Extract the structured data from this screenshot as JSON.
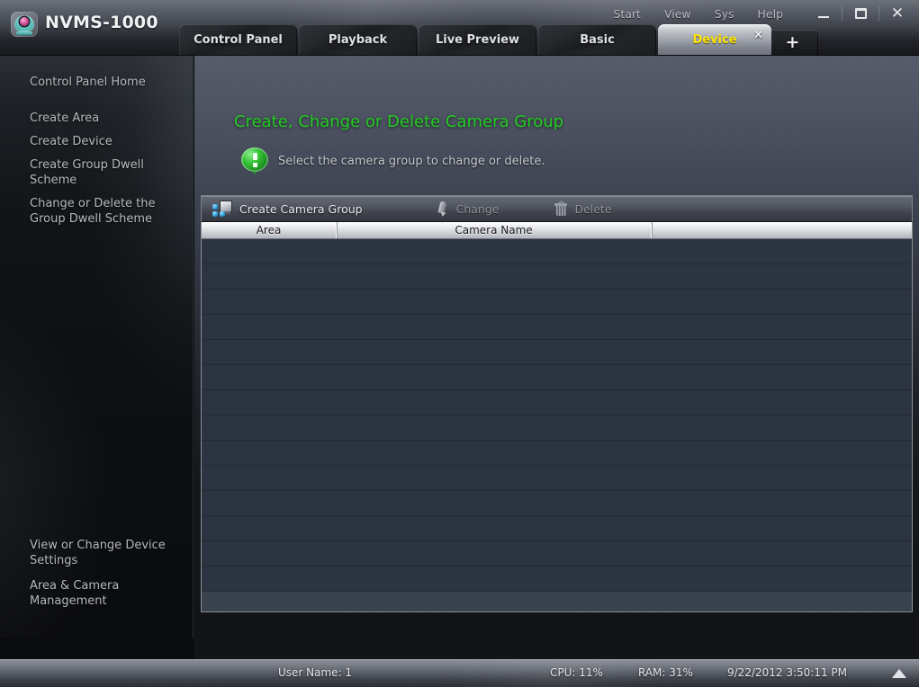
{
  "window": {
    "app_title": "NVMS-1000",
    "logo_icon": "camera-icon",
    "menus": [
      "Start",
      "View",
      "Sys",
      "Help"
    ],
    "controls": {
      "minimize": "minimize-icon",
      "maximize": "maximize-icon",
      "close": "✕"
    }
  },
  "tabs": {
    "items": [
      {
        "label": "Control Panel",
        "active": false
      },
      {
        "label": "Playback",
        "active": false
      },
      {
        "label": "Live Preview",
        "active": false
      },
      {
        "label": "Basic",
        "active": false
      },
      {
        "label": "Device",
        "active": true,
        "close": "✕"
      }
    ],
    "add_label": "+"
  },
  "sidebar": {
    "home": "Control Panel Home",
    "top_items": [
      "Create Area",
      "Create Device",
      "Create Group Dwell Scheme",
      "Change or Delete the Group Dwell Scheme"
    ],
    "bottom_items": [
      "View or Change Device Settings",
      "Area & Camera Management"
    ]
  },
  "main": {
    "page_title": "Create, Change or Delete Camera Group",
    "hint_icon": "info-balloon-icon",
    "hint_text": "Select the camera group to change or delete.",
    "toolbar": {
      "create": {
        "label": "Create Camera Group",
        "icon": "create-camera-group-icon",
        "enabled": true
      },
      "change": {
        "label": "Change",
        "icon": "pencil-icon",
        "enabled": false
      },
      "delete": {
        "label": "Delete",
        "icon": "trash-icon",
        "enabled": false
      }
    },
    "table": {
      "columns": [
        "Area",
        "Camera Name",
        ""
      ],
      "rows": []
    }
  },
  "statusbar": {
    "user_name": "User Name: 1",
    "cpu": "CPU: 11%",
    "ram": "RAM: 31%",
    "datetime": "9/22/2012 3:50:11 PM",
    "expand_icon": "triangle-up-icon"
  },
  "colors": {
    "accent_green": "#22cc22",
    "active_tab_text": "#ffe400",
    "panel_dark": "#121417",
    "table_row": "#2b3440"
  }
}
